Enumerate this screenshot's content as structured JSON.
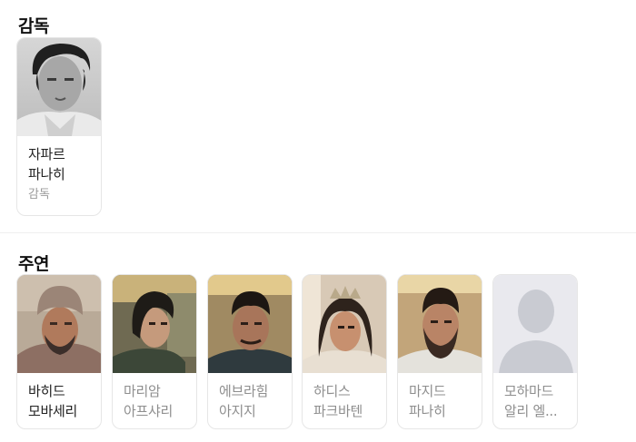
{
  "director_section": {
    "title": "감독",
    "people": [
      {
        "name": "자파르 파나히",
        "role": "감독",
        "photo_icon": "portrait-photo"
      }
    ]
  },
  "cast_section": {
    "title": "주연",
    "people": [
      {
        "name": "바히드 모바세리",
        "photo_icon": "portrait-photo"
      },
      {
        "name": "마리암 아프샤리",
        "photo_icon": "portrait-photo"
      },
      {
        "name": "에브라힘 아지지",
        "photo_icon": "portrait-photo"
      },
      {
        "name": "하디스 파크바텐",
        "photo_icon": "portrait-photo"
      },
      {
        "name": "마지드 파나히",
        "photo_icon": "portrait-photo"
      },
      {
        "name": "모하마드 알리 엘...",
        "photo_icon": "default-avatar-icon"
      }
    ]
  }
}
